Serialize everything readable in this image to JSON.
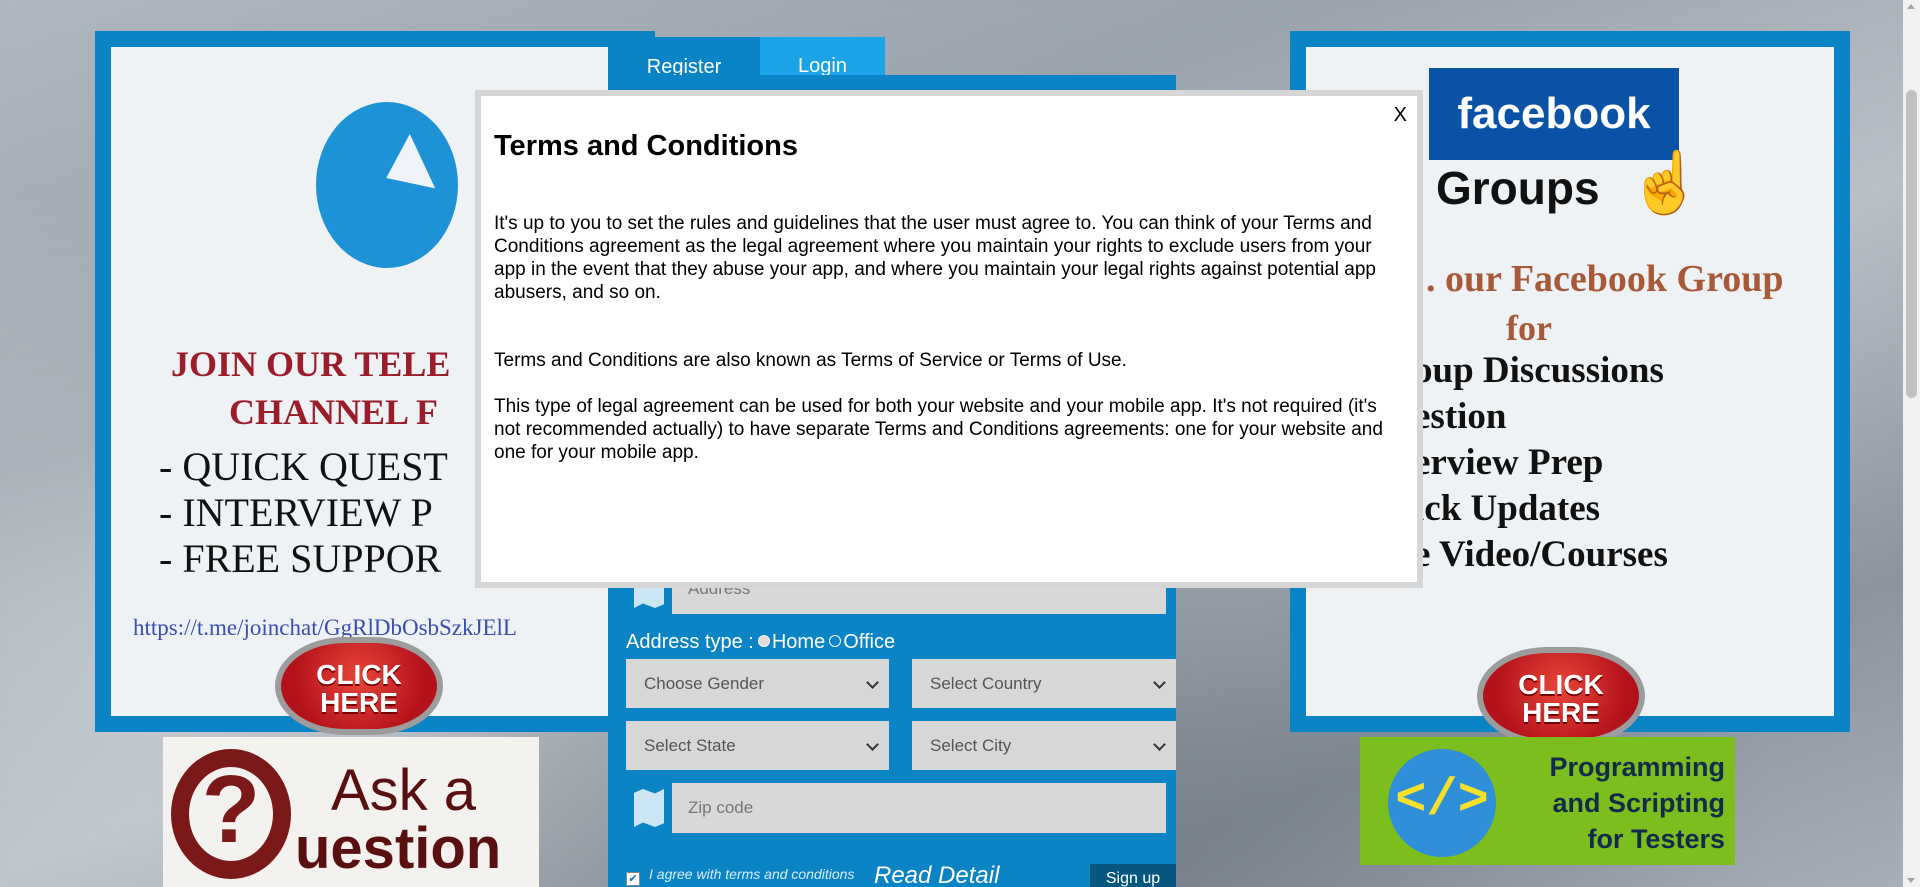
{
  "tabs": {
    "register": "Register",
    "login": "Login"
  },
  "left_banner": {
    "heading_1": "JOIN OUR TELE",
    "heading_2": "CHANNEL  F",
    "items": [
      "- QUICK QUEST",
      "- INTERVIEW P",
      "- FREE SUPPOR"
    ],
    "link": "https://t.me/joinchat/GgRlDbOsbSzkJElL",
    "click_line1": "CLICK",
    "click_line2": "HERE"
  },
  "right_banner": {
    "fb_logo": "facebook",
    "groups": "Groups",
    "heading_1": ". our Facebook Group",
    "heading_2": "for",
    "items": [
      "oup Discussions",
      "estion",
      "erview Prep",
      "ick Updates",
      "e Video/Courses"
    ],
    "click_line1": "CLICK",
    "click_line2": "HERE"
  },
  "ask_ad": {
    "line1": "Ask a",
    "line2": "uestion",
    "glyph": "?"
  },
  "prog_ad": {
    "line1": "Programming",
    "line2": "and Scripting",
    "line3": "for Testers",
    "glyph": "</>"
  },
  "form": {
    "address_placeholder": "Address",
    "address_type_label": "Address type :",
    "address_type_options": [
      "Home",
      "Office"
    ],
    "address_type_selected": "Home",
    "gender": "Choose Gender",
    "country": "Select Country",
    "state": "Select State",
    "city": "Select City",
    "zip_placeholder": "Zip code",
    "agree_text": "I agree with terms and conditions",
    "read_detail": "Read Detail",
    "signup": "Sign up"
  },
  "modal": {
    "title": "Terms and Conditions",
    "close": "X",
    "paragraphs": [
      "It's up to you to set the rules and guidelines that the user must agree to. You can think of your Terms and Conditions agreement as the legal agreement where you maintain your rights to exclude users from your app in the event that they abuse your app, and where you maintain your legal rights against potential app abusers, and so on.",
      "Terms and Conditions are also known as Terms of Service or Terms of Use.",
      "This type of legal agreement can be used for both your website and your mobile app. It's not required (it's not recommended actually) to have separate Terms and Conditions agreements: one for your website and one for your mobile app."
    ]
  },
  "colors": {
    "form_blue": "#0b84c6",
    "login_tab": "#1aa3e6",
    "overlay_border": "#d6d6d6"
  }
}
